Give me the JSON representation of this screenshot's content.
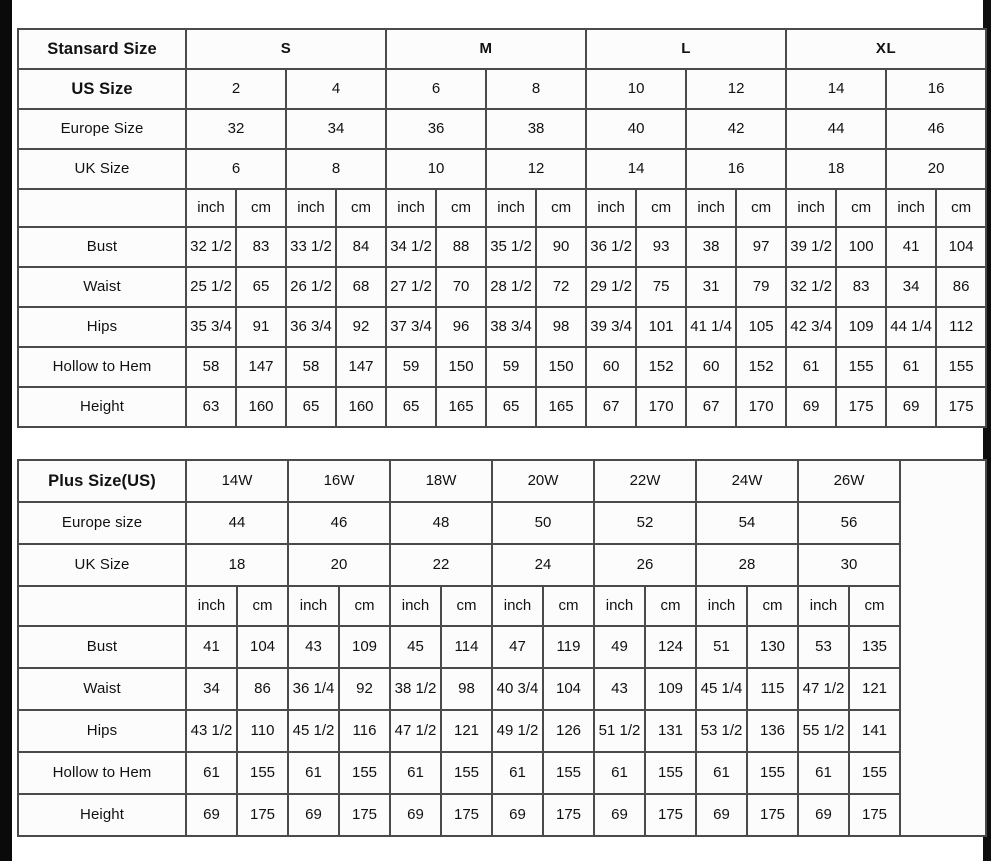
{
  "standard_table": {
    "corner_label": "Stansard Size",
    "group_headers": [
      "S",
      "M",
      "L",
      "XL"
    ],
    "row_labels": {
      "us": "US Size",
      "europe": "Europe Size",
      "uk": "UK Size",
      "bust": "Bust",
      "waist": "Waist",
      "hips": "Hips",
      "hollow": "Hollow to Hem",
      "height": "Height"
    },
    "units": [
      "inch",
      "cm"
    ],
    "us_sizes": [
      "2",
      "4",
      "6",
      "8",
      "10",
      "12",
      "14",
      "16"
    ],
    "europe_sizes": [
      "32",
      "34",
      "36",
      "38",
      "40",
      "42",
      "44",
      "46"
    ],
    "uk_sizes": [
      "6",
      "8",
      "10",
      "12",
      "14",
      "16",
      "18",
      "20"
    ],
    "measurements": {
      "bust": [
        "32 1/2",
        "83",
        "33 1/2",
        "84",
        "34 1/2",
        "88",
        "35 1/2",
        "90",
        "36 1/2",
        "93",
        "38",
        "97",
        "39 1/2",
        "100",
        "41",
        "104"
      ],
      "waist": [
        "25 1/2",
        "65",
        "26 1/2",
        "68",
        "27 1/2",
        "70",
        "28 1/2",
        "72",
        "29 1/2",
        "75",
        "31",
        "79",
        "32 1/2",
        "83",
        "34",
        "86"
      ],
      "hips": [
        "35 3/4",
        "91",
        "36 3/4",
        "92",
        "37 3/4",
        "96",
        "38 3/4",
        "98",
        "39 3/4",
        "101",
        "41 1/4",
        "105",
        "42 3/4",
        "109",
        "44 1/4",
        "112"
      ],
      "hollow": [
        "58",
        "147",
        "58",
        "147",
        "59",
        "150",
        "59",
        "150",
        "60",
        "152",
        "60",
        "152",
        "61",
        "155",
        "61",
        "155"
      ],
      "height": [
        "63",
        "160",
        "65",
        "160",
        "65",
        "165",
        "65",
        "165",
        "67",
        "170",
        "67",
        "170",
        "69",
        "175",
        "69",
        "175"
      ]
    }
  },
  "plus_table": {
    "corner_label": "Plus Size(US)",
    "row_labels": {
      "europe": "Europe size",
      "uk": "UK Size",
      "bust": "Bust",
      "waist": "Waist",
      "hips": "Hips",
      "hollow": "Hollow to Hem",
      "height": "Height"
    },
    "units": [
      "inch",
      "cm"
    ],
    "us_sizes": [
      "14W",
      "16W",
      "18W",
      "20W",
      "22W",
      "24W",
      "26W"
    ],
    "europe_sizes": [
      "44",
      "46",
      "48",
      "50",
      "52",
      "54",
      "56"
    ],
    "uk_sizes": [
      "18",
      "20",
      "22",
      "24",
      "26",
      "28",
      "30"
    ],
    "measurements": {
      "bust": [
        "41",
        "104",
        "43",
        "109",
        "45",
        "114",
        "47",
        "119",
        "49",
        "124",
        "51",
        "130",
        "53",
        "135"
      ],
      "waist": [
        "34",
        "86",
        "36 1/4",
        "92",
        "38 1/2",
        "98",
        "40 3/4",
        "104",
        "43",
        "109",
        "45 1/4",
        "115",
        "47 1/2",
        "121"
      ],
      "hips": [
        "43 1/2",
        "110",
        "45 1/2",
        "116",
        "47 1/2",
        "121",
        "49 1/2",
        "126",
        "51 1/2",
        "131",
        "53 1/2",
        "136",
        "55 1/2",
        "141"
      ],
      "hollow": [
        "61",
        "155",
        "61",
        "155",
        "61",
        "155",
        "61",
        "155",
        "61",
        "155",
        "61",
        "155",
        "61",
        "155"
      ],
      "height": [
        "69",
        "175",
        "69",
        "175",
        "69",
        "175",
        "69",
        "175",
        "69",
        "175",
        "69",
        "175",
        "69",
        "175"
      ]
    }
  }
}
